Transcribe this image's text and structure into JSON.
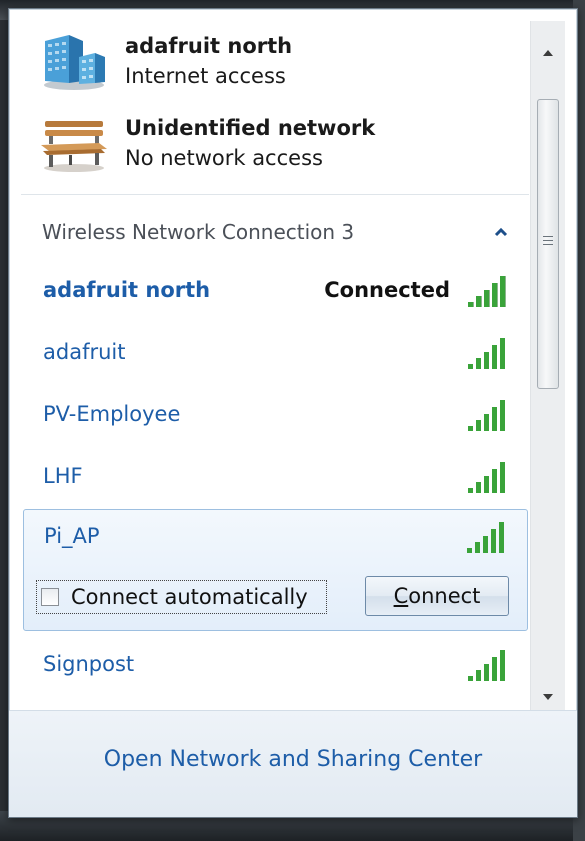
{
  "active_networks": [
    {
      "name": "adafruit north",
      "status": "Internet access",
      "icon": "building-network-icon"
    },
    {
      "name": "Unidentified network",
      "status": "No network access",
      "icon": "park-bench-icon"
    }
  ],
  "section": {
    "title": "Wireless Network Connection 3",
    "collapse_icon": "chevron-up-icon"
  },
  "networks": [
    {
      "name": "adafruit north",
      "status": "Connected",
      "signal_bars": 5
    },
    {
      "name": "adafruit",
      "signal_bars": 5
    },
    {
      "name": "PV-Employee",
      "signal_bars": 5
    },
    {
      "name": "LHF",
      "signal_bars": 5
    },
    {
      "name": "Pi_AP",
      "signal_bars": 5,
      "selected": true
    },
    {
      "name": "Signpost",
      "signal_bars": 5
    }
  ],
  "selected_network": {
    "checkbox_label": "Connect automatically",
    "checkbox_checked": false,
    "connect_label_first": "C",
    "connect_label_rest": "onnect"
  },
  "footer": {
    "link": "Open Network and Sharing Center"
  },
  "colors": {
    "link_blue": "#1d5da8",
    "signal_green": "#3aa33a",
    "selection_border": "#9dbfe0"
  }
}
